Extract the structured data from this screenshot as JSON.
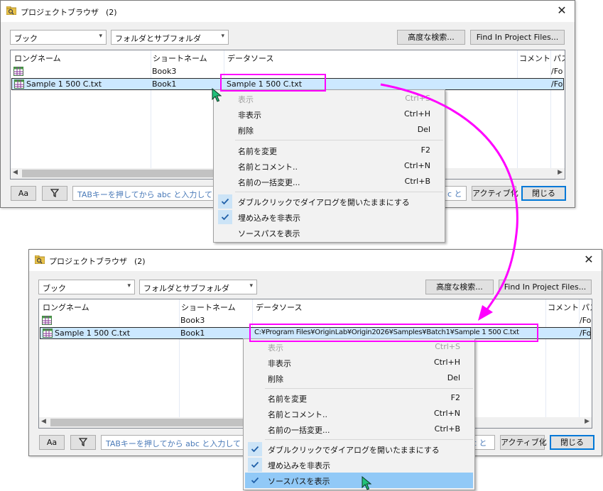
{
  "colors": {
    "accent": "#ff00ff",
    "selection": "#cce8ff",
    "hint_text": "#4a7ab8",
    "checkmark_bg": "#cce4f7",
    "menu_highlight": "#91c9f7"
  },
  "top": {
    "title": "プロジェクトブラウザ",
    "count": "(2)",
    "type_combo": "ブック",
    "scope_combo": "フォルダとサブフォルダ",
    "advanced_search": "高度な検索...",
    "find_in_files": "Find In Project Files...",
    "columns": [
      "ロングネーム",
      "ショートネーム",
      "データソース",
      "コメント",
      "パス"
    ],
    "rows": [
      {
        "long": "",
        "short": "Book3",
        "source": "",
        "path": "/Fo"
      },
      {
        "long": "Sample 1 500 C.txt",
        "short": "Book1",
        "source": "Sample 1 500 C.txt",
        "path": "/Fo"
      }
    ],
    "aa_label": "Aa",
    "hint": "TABキーを押してから abc と入力して",
    "hint_tail": "c と",
    "activate": "アクティブ化",
    "close": "閉じる"
  },
  "bottom": {
    "title": "プロジェクトブラウザ",
    "count": "(2)",
    "type_combo": "ブック",
    "scope_combo": "フォルダとサブフォルダ",
    "advanced_search": "高度な検索...",
    "find_in_files": "Find In Project Files...",
    "columns": [
      "ロングネーム",
      "ショートネーム",
      "データソース",
      "コメント",
      "パス"
    ],
    "rows": [
      {
        "long": "",
        "short": "Book3",
        "source": "",
        "path": "/Fo"
      },
      {
        "long": "Sample 1 500 C.txt",
        "short": "Book1",
        "source": "C:¥Program Files¥OriginLab¥Origin2026¥Samples¥Batch1¥Sample 1 500 C.txt",
        "path": "/Fo"
      }
    ],
    "aa_label": "Aa",
    "hint": "TABキーを押してから abc と入力して",
    "hint_tail": "c と",
    "activate": "アクティブ化",
    "close": "閉じる"
  },
  "menu": {
    "items": [
      {
        "label": "表示",
        "shortcut": "Ctrl+S"
      },
      {
        "label": "非表示",
        "shortcut": "Ctrl+H"
      },
      {
        "label": "削除",
        "shortcut": "Del"
      },
      {
        "label": "名前を変更",
        "shortcut": "F2"
      },
      {
        "label": "名前とコメント..",
        "shortcut": "Ctrl+N"
      },
      {
        "label": "名前の一括変更...",
        "shortcut": "Ctrl+B"
      },
      {
        "label": "ダブルクリックでダイアログを開いたままにする",
        "shortcut": ""
      },
      {
        "label": "埋め込みを非表示",
        "shortcut": ""
      },
      {
        "label": "ソースパスを表示",
        "shortcut": ""
      }
    ]
  }
}
